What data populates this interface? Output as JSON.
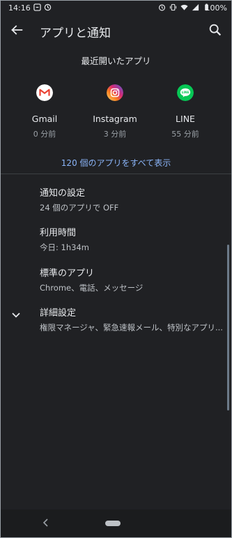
{
  "status_bar": {
    "time": "14:16",
    "battery": "100%"
  },
  "header": {
    "title": "アプリと通知"
  },
  "recent": {
    "heading": "最近開いたアプリ",
    "apps": [
      {
        "name": "Gmail",
        "time": "0 分前",
        "icon": "gmail-icon",
        "color": "#ffffff"
      },
      {
        "name": "Instagram",
        "time": "3 分前",
        "icon": "instagram-icon",
        "color": "#c13584"
      },
      {
        "name": "LINE",
        "time": "55 分前",
        "icon": "line-icon",
        "color": "#06c755"
      }
    ],
    "show_all": "120 個のアプリをすべて表示"
  },
  "settings": [
    {
      "title": "通知の設定",
      "subtitle": "24 個のアプリで OFF"
    },
    {
      "title": "利用時間",
      "subtitle": "今日: 1h34m"
    },
    {
      "title": "標準のアプリ",
      "subtitle": "Chrome、電話、メッセージ"
    },
    {
      "title": "詳細設定",
      "subtitle": "権限マネージャ、緊急速報メール、特別なアプリ..."
    }
  ],
  "colors": {
    "background": "#202124",
    "accent": "#8ab4f8"
  }
}
